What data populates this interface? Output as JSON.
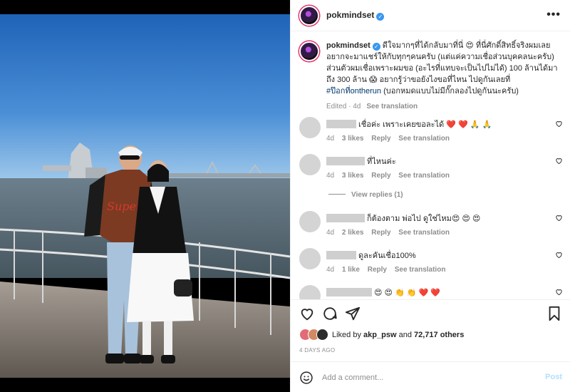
{
  "header": {
    "username": "pokmindset",
    "more_label": "•••"
  },
  "caption": {
    "username": "pokmindset",
    "line1": "ดีใจมากๆที่ได้กลับมาที่นี่ 😍 ที่นี่ศักดิ์สิทธิ์จริงผมเลย",
    "line2": "อยากจะมาแชร์ให้กับทุกๆคนครับ (แต่แค่ความเชื่อส่วนบุคคลนะครับ)",
    "line3": "ส่วนตัวผมเชื่อเพราะผมขอ (อะไรที่แทบจะเป็นไปไม่ได้) 100 ล้านได้มา",
    "line4": "ถึง 300 ล้าน 😱 อยากรู้ว่าขอยังไงขอที่ไหน ไปดูกันเลยที่",
    "hashtag": "#ป๊อกที่ontherun",
    "line5": "(บอกหมดแบบไม่มีกั๊กลองไปดูกันนะครับ)",
    "edited": "Edited · 4d",
    "see_translation": "See translation"
  },
  "comments": [
    {
      "text": "เชื่อค่ะ เพราะเคยขอละได้ ❤️ ❤️ 🙏 🙏",
      "age": "4d",
      "likes": "3 likes",
      "reply": "Reply",
      "translate": "See translation"
    },
    {
      "text": "ที่ไหนค่ะ",
      "age": "4d",
      "likes": "3 likes",
      "reply": "Reply",
      "translate": "See translation"
    },
    {
      "text": "ก็ต้องตาม พ่อไป ดูใช่ไหม😍 😍 😍",
      "age": "4d",
      "likes": "2 likes",
      "reply": "Reply",
      "translate": "See translation"
    },
    {
      "text": "ดูละคันเชื่อ100%",
      "age": "4d",
      "likes": "1 like",
      "reply": "Reply",
      "translate": "See translation"
    },
    {
      "text": "😍 😍 👏 👏 ❤️ ❤️",
      "age": "",
      "likes": "",
      "reply": "",
      "translate": ""
    }
  ],
  "view_replies": "View replies (1)",
  "likes": {
    "prefix": "Liked by",
    "user": "akp_psw",
    "and": "and",
    "others": "72,717 others"
  },
  "time_ago": "4 DAYS AGO",
  "add_comment": {
    "placeholder": "Add a comment...",
    "post_label": "Post"
  },
  "colors": {
    "link": "#00376b",
    "meta": "#8e8e8e",
    "verified": "#3897f0",
    "post_disabled": "#b2dffc",
    "like_red": "#ed4956"
  }
}
